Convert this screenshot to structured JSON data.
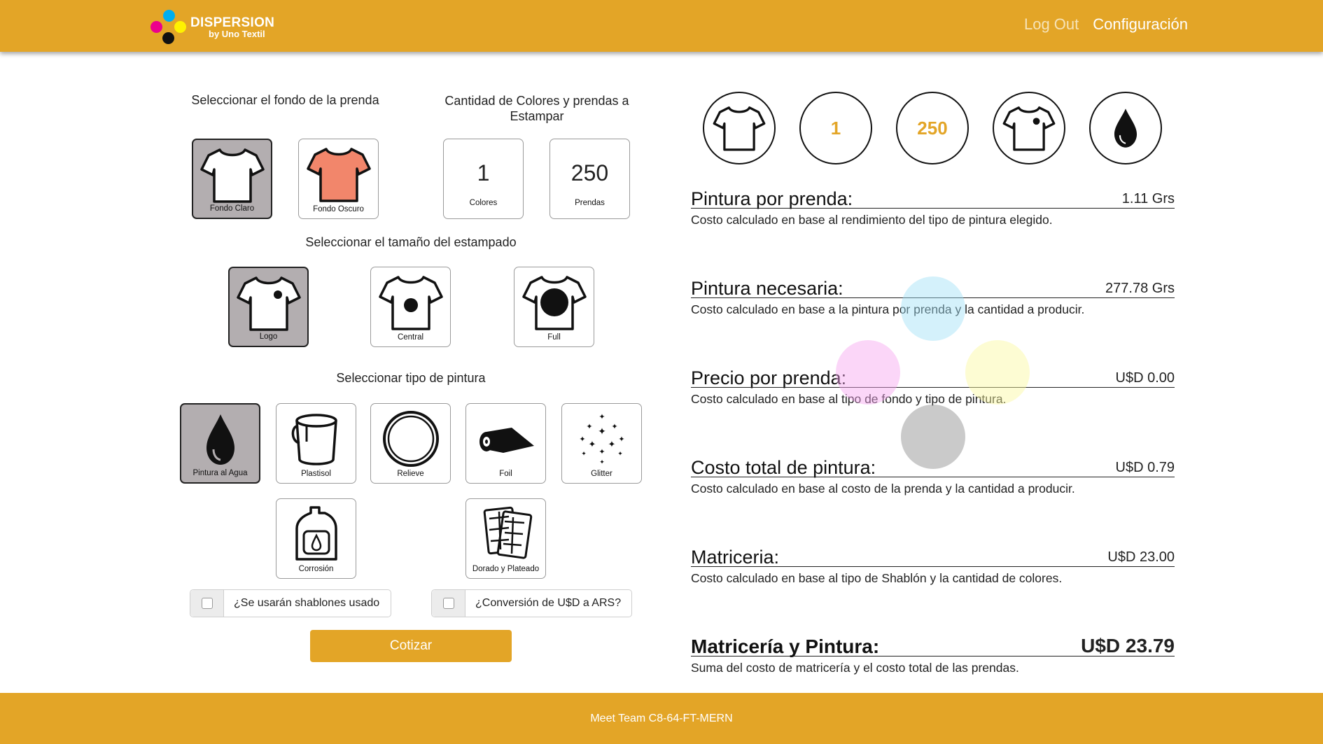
{
  "header": {
    "brand": "DISPERSION",
    "brand_sub": "by Uno Textil",
    "nav": {
      "logout": "Log Out",
      "config": "Configuración"
    },
    "logo_colors": [
      "#00AEEF",
      "#EC008C",
      "#FFF200",
      "#111111"
    ]
  },
  "fondo": {
    "title": "Seleccionar el fondo de la prenda",
    "options": [
      {
        "label": "Fondo Claro",
        "selected": true,
        "shirt_color": "#ffffff"
      },
      {
        "label": "Fondo Oscuro",
        "selected": false,
        "shirt_color": "#F2866B"
      }
    ]
  },
  "cantidad": {
    "title": "Cantidad de Colores y prendas a Estampar",
    "colores": {
      "value": "1",
      "label": "Colores"
    },
    "prendas": {
      "value": "250",
      "label": "Prendas"
    }
  },
  "tamano": {
    "title": "Seleccionar el tamaño del estampado",
    "options": [
      {
        "label": "Logo",
        "selected": true
      },
      {
        "label": "Central",
        "selected": false
      },
      {
        "label": "Full",
        "selected": false
      }
    ]
  },
  "pintura": {
    "title": "Seleccionar tipo de pintura",
    "options": [
      {
        "label": "Pintura al Agua",
        "icon": "water-drop-icon",
        "selected": true
      },
      {
        "label": "Plastisol",
        "icon": "bucket-icon",
        "selected": false
      },
      {
        "label": "Relieve",
        "icon": "ring-icon",
        "selected": false
      },
      {
        "label": "Foil",
        "icon": "foil-roll-icon",
        "selected": false
      },
      {
        "label": "Glitter",
        "icon": "sparkles-icon",
        "selected": false
      },
      {
        "label": "Corrosión",
        "icon": "chemical-bottle-icon",
        "selected": false
      },
      {
        "label": "Dorado y Plateado",
        "icon": "foil-sheets-icon",
        "selected": false
      }
    ]
  },
  "checks": {
    "shablones": {
      "label": "¿Se usarán shablones usado",
      "checked": false
    },
    "conversion": {
      "label": "¿Conversión de U$D a ARS?",
      "checked": false
    }
  },
  "cotizar_label": "Cotizar",
  "summary": {
    "colores": "1",
    "prendas": "250"
  },
  "results": [
    {
      "title": "Pintura por prenda:",
      "value": "1.11 Grs",
      "desc": "Costo calculado en base al rendimiento del tipo de pintura elegido."
    },
    {
      "title": "Pintura necesaria:",
      "value": "277.78 Grs",
      "desc": "Costo calculado en base a la pintura por prenda y la cantidad a producir."
    },
    {
      "title": "Precio por prenda:",
      "value": "U$D 0.00",
      "desc": "Costo calculado en base al tipo de fondo y tipo de pintura."
    },
    {
      "title": "Costo total de pintura:",
      "value": "U$D 0.79",
      "desc": "Costo calculado en base al costo de la prenda y la cantidad a producir."
    },
    {
      "title": "Matriceria:",
      "value": "U$D 23.00",
      "desc": "Costo calculado en base al tipo de Shablón y la cantidad de colores."
    }
  ],
  "total": {
    "title": "Matricería y Pintura:",
    "value": "U$D 23.79",
    "desc": "Suma del costo de matricería y el costo total de las prendas."
  },
  "footer": {
    "text": "Meet Team C8-64-FT-MERN"
  },
  "colors": {
    "accent": "#E3A527",
    "selected_card": "#B3AEB0"
  }
}
